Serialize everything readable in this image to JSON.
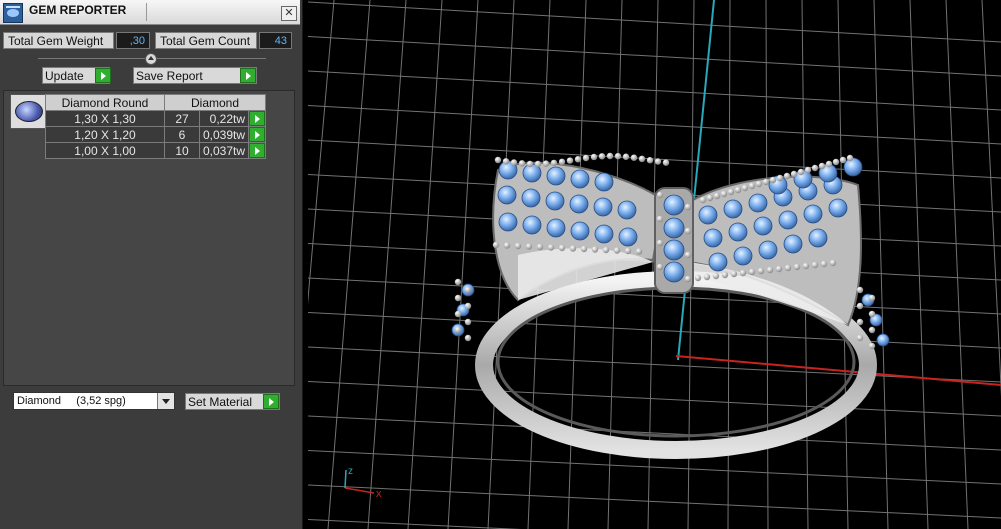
{
  "window": {
    "title": "GEM REPORTER",
    "close_glyph": "✕"
  },
  "totals": {
    "weight_label": "Total Gem Weight",
    "weight_value": ",30",
    "count_label": "Total Gem Count",
    "count_value": "43"
  },
  "buttons": {
    "update": "Update",
    "save_report": "Save Report",
    "set_material": "Set Material"
  },
  "table": {
    "headers": [
      "Diamond Round",
      "Diamond"
    ],
    "rows": [
      {
        "size": "1,30 X 1,30",
        "count": "27",
        "weight": "0,22tw"
      },
      {
        "size": "1,20 X 1,20",
        "count": "6",
        "weight": "0,039tw"
      },
      {
        "size": "1,00 X 1,00",
        "count": "10",
        "weight": "0,037tw"
      }
    ]
  },
  "material": {
    "selected": "Diamond     (3,52 spg)"
  },
  "viewport": {
    "axis_labels": {
      "x": "x",
      "z": "z"
    },
    "colors": {
      "grid": "#8f8f8f",
      "x_axis": "#c8231f",
      "y_axis": "#2aa7b8",
      "gem": "#7fb2f0",
      "metal": "#c9c9c9"
    }
  }
}
